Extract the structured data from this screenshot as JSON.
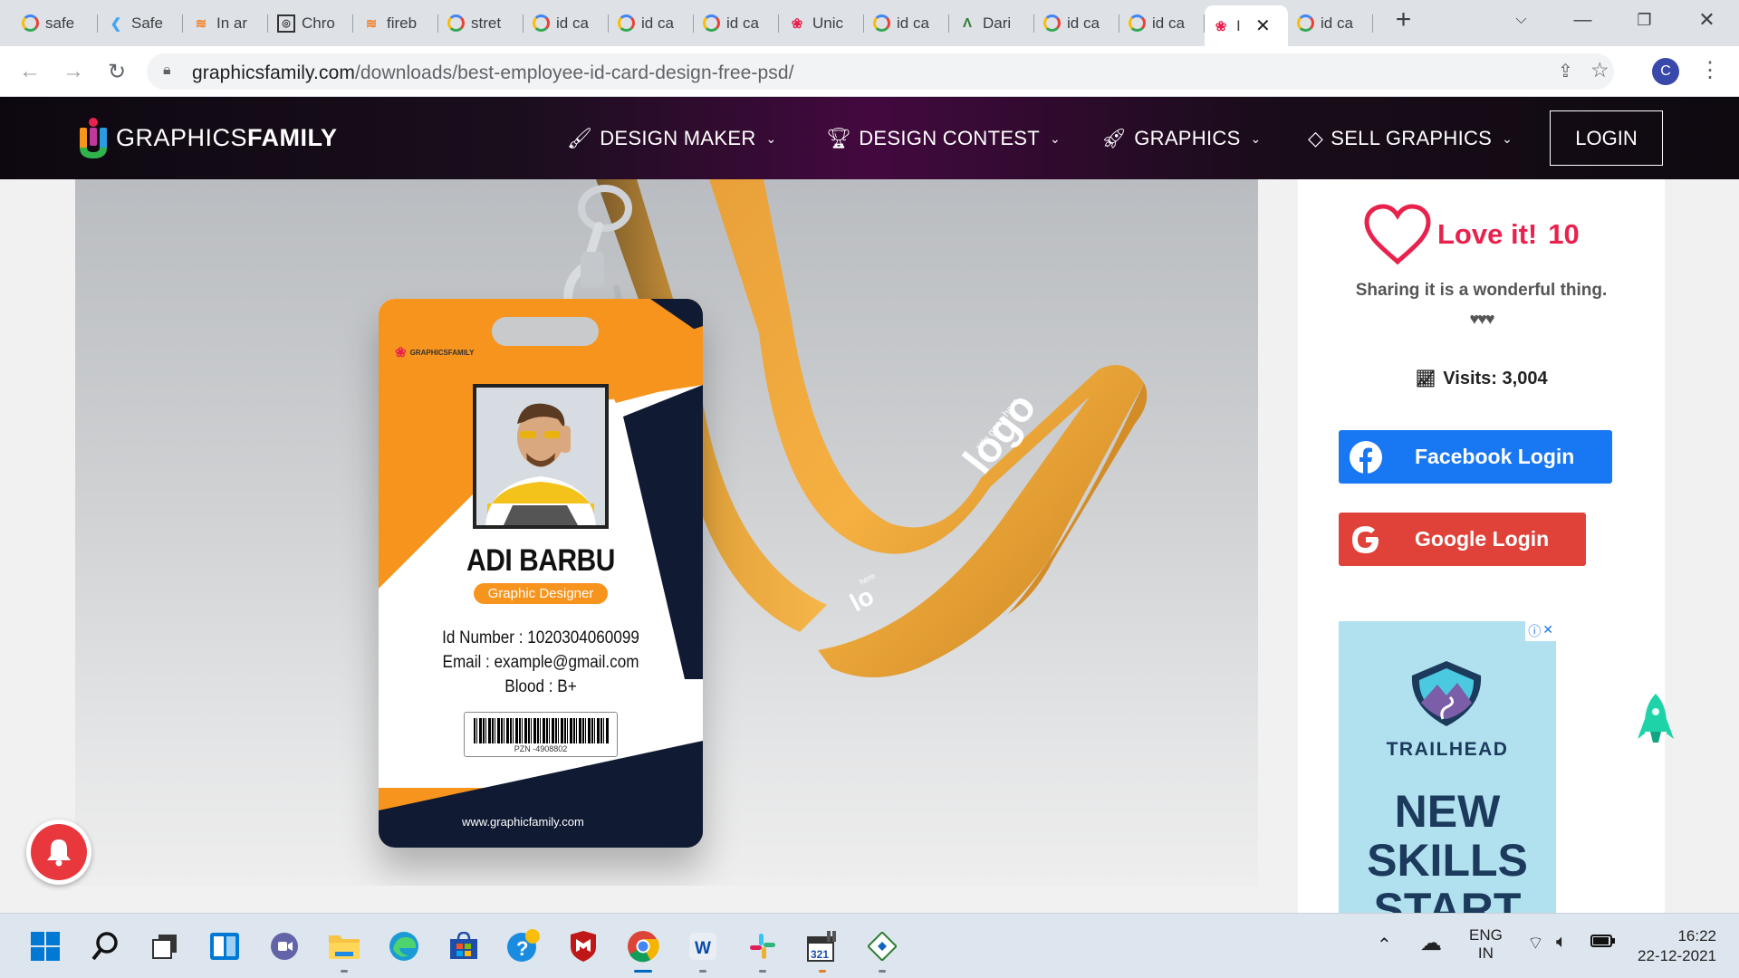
{
  "browser": {
    "tabs": [
      {
        "label": "safe",
        "favicon": "google-icon"
      },
      {
        "label": "Safe",
        "favicon": "flutter-icon"
      },
      {
        "label": "In ar",
        "favicon": "stackoverflow-icon"
      },
      {
        "label": "Chro",
        "favicon": "chrome-devs-icon"
      },
      {
        "label": "fireb",
        "favicon": "stackoverflow-icon"
      },
      {
        "label": "stret",
        "favicon": "google-icon"
      },
      {
        "label": "id ca",
        "favicon": "google-icon"
      },
      {
        "label": "id ca",
        "favicon": "google-icon"
      },
      {
        "label": "id ca",
        "favicon": "google-icon"
      },
      {
        "label": "Unic",
        "favicon": "graphicsfamily-icon"
      },
      {
        "label": "id ca",
        "favicon": "google-icon"
      },
      {
        "label": "Dari",
        "favicon": "android-icon"
      },
      {
        "label": "id ca",
        "favicon": "google-icon"
      },
      {
        "label": "id ca",
        "favicon": "google-icon"
      },
      {
        "label": "I",
        "favicon": "graphicsfamily-icon",
        "active": true
      },
      {
        "label": "id ca",
        "favicon": "google-icon"
      }
    ],
    "url_domain": "graphicsfamily.com",
    "url_path": "/downloads/best-employee-id-card-design-free-psd/",
    "profile_initial": "C"
  },
  "site": {
    "logo_light": "GRAPHICS",
    "logo_bold": "FAMILY",
    "menu": [
      "DESIGN MAKER",
      "DESIGN CONTEST",
      "GRAPHICS",
      "SELL GRAPHICS"
    ],
    "login": "LOGIN"
  },
  "card": {
    "logo_text": "GRAPHICSFAMILY",
    "name": "ADI BARBU",
    "role": "Graphic Designer",
    "id_line": "Id Number : 1020304060099",
    "email_line": "Email : example@gmail.com",
    "blood_line": "Blood : B+",
    "barcode_text": "PZN -4908802",
    "website": "www.graphicfamily.com",
    "lanyard_text_small": "title goes here",
    "lanyard_logo": "logo",
    "lanyard_text_small_2": "here",
    "lanyard_logo_2": "lo",
    "accent_color": "#f7941d",
    "dark_color": "#101a33"
  },
  "sidebar": {
    "love_label": "Love it!",
    "love_count": "10",
    "share_text": "Sharing it is a wonderful thing.",
    "hearts": "♥♥♥",
    "visits": "Visits: 3,004",
    "facebook_login": "Facebook Login",
    "google_login": "Google Login",
    "ad_brand": "TRAILHEAD",
    "ad_headline_1": "NEW",
    "ad_headline_2": "SKILLS",
    "ad_headline_3": "START"
  },
  "taskbar": {
    "lang_1": "ENG",
    "lang_2": "IN",
    "time": "16:22",
    "date": "22-12-2021"
  }
}
